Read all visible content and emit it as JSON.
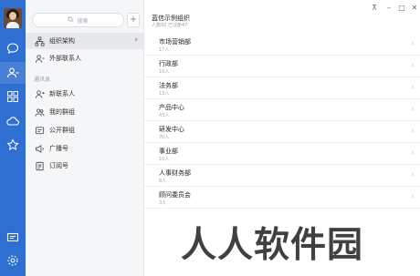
{
  "search": {
    "placeholder": "搜索"
  },
  "nav": {
    "org": "组织架构",
    "external": "外部联系人",
    "section_label": "通讯录",
    "new_contacts": "新联系人",
    "my_groups": "我的群组",
    "public_groups": "公开群组",
    "broadcast": "广播号",
    "subscription": "订阅号"
  },
  "org": {
    "title": "蓝信示例组织",
    "subtitle": "人数92 已注册47"
  },
  "departments": [
    {
      "name": "市场营销部",
      "count": "17人"
    },
    {
      "name": "行政部",
      "count": "10人"
    },
    {
      "name": "法务部",
      "count": "13人"
    },
    {
      "name": "产品中心",
      "count": "43人"
    },
    {
      "name": "研发中心",
      "count": "70人"
    },
    {
      "name": "事业部",
      "count": "10人"
    },
    {
      "name": "人事财务部",
      "count": "8人"
    },
    {
      "name": "顾问委员会",
      "count": "3人"
    }
  ],
  "watermark": "人人软件园",
  "colors": {
    "rail": "#2f6fd1",
    "panel": "#f5f6f8"
  }
}
